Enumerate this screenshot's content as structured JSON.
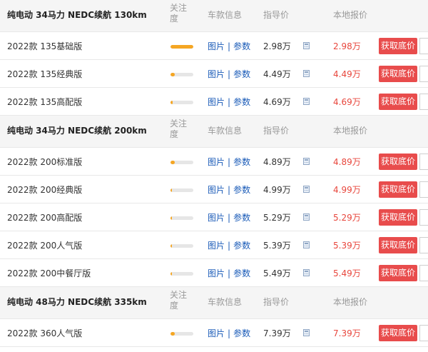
{
  "colors": {
    "accent": "#e84c4c",
    "price_red": "#e8463c",
    "link_blue": "#1a5bb8",
    "bar_fill": "#f5a623",
    "header_bg": "#f5f5f5"
  },
  "groups": [
    {
      "name": "纯电动 34马力 NEDC续航 130km",
      "col_attention": "关注度",
      "col_info": "车款信息",
      "col_guide": "指导价",
      "col_local": "本地报价",
      "rows": [
        {
          "name": "2022款 135基础版",
          "attention": 1.0,
          "pic": "图片",
          "sep": "|",
          "param": "参数",
          "guide": "2.98万",
          "local": "2.98万",
          "btn": "获取底价"
        },
        {
          "name": "2022款 135经典版",
          "attention": 0.2,
          "pic": "图片",
          "sep": "|",
          "param": "参数",
          "guide": "4.49万",
          "local": "4.49万",
          "btn": "获取底价"
        },
        {
          "name": "2022款 135高配版",
          "attention": 0.1,
          "pic": "图片",
          "sep": "|",
          "param": "参数",
          "guide": "4.69万",
          "local": "4.69万",
          "btn": "获取底价"
        }
      ]
    },
    {
      "name": "纯电动 34马力 NEDC续航 200km",
      "col_attention": "关注度",
      "col_info": "车款信息",
      "col_guide": "指导价",
      "col_local": "本地报价",
      "rows": [
        {
          "name": "2022款 200标准版",
          "attention": 0.18,
          "pic": "图片",
          "sep": "|",
          "param": "参数",
          "guide": "4.89万",
          "local": "4.89万",
          "btn": "获取底价"
        },
        {
          "name": "2022款 200经典版",
          "attention": 0.05,
          "pic": "图片",
          "sep": "|",
          "param": "参数",
          "guide": "4.99万",
          "local": "4.99万",
          "btn": "获取底价"
        },
        {
          "name": "2022款 200高配版",
          "attention": 0.05,
          "pic": "图片",
          "sep": "|",
          "param": "参数",
          "guide": "5.29万",
          "local": "5.29万",
          "btn": "获取底价"
        },
        {
          "name": "2022款 200人气版",
          "attention": 0.05,
          "pic": "图片",
          "sep": "|",
          "param": "参数",
          "guide": "5.39万",
          "local": "5.39万",
          "btn": "获取底价"
        },
        {
          "name": "2022款 200中餐厅版",
          "attention": 0.05,
          "pic": "图片",
          "sep": "|",
          "param": "参数",
          "guide": "5.49万",
          "local": "5.49万",
          "btn": "获取底价"
        }
      ]
    },
    {
      "name": "纯电动 48马力 NEDC续航 335km",
      "col_attention": "关注度",
      "col_info": "车款信息",
      "col_guide": "指导价",
      "col_local": "本地报价",
      "rows": [
        {
          "name": "2022款 360人气版",
          "attention": 0.18,
          "pic": "图片",
          "sep": "|",
          "param": "参数",
          "guide": "7.39万",
          "local": "7.39万",
          "btn": "获取底价"
        }
      ]
    }
  ]
}
